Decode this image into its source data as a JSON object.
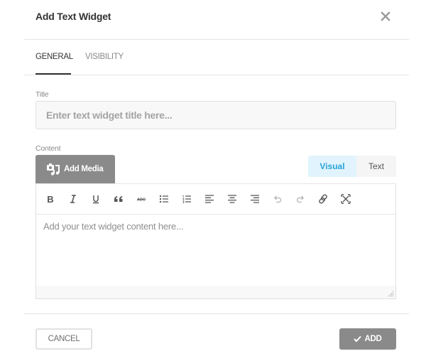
{
  "dialog": {
    "title": "Add Text Widget",
    "close_icon": "close-icon"
  },
  "tabs": [
    {
      "label": "GENERAL",
      "active": true
    },
    {
      "label": "VISIBILITY",
      "active": false
    }
  ],
  "form": {
    "title_label": "Title",
    "title_value": "",
    "title_placeholder": "Enter text widget title here...",
    "content_label": "Content",
    "add_media_label": "Add Media",
    "add_media_icon": "add-media-icon",
    "editor_modes": [
      {
        "label": "Visual",
        "active": true
      },
      {
        "label": "Text",
        "active": false
      }
    ],
    "toolbar": [
      {
        "name": "bold",
        "icon": "bold-icon"
      },
      {
        "name": "italic",
        "icon": "italic-icon"
      },
      {
        "name": "underline",
        "icon": "underline-icon"
      },
      {
        "name": "blockquote",
        "icon": "quote-icon"
      },
      {
        "name": "strikethrough",
        "icon": "strikethrough-icon"
      },
      {
        "name": "bulleted-list",
        "icon": "bullet-list-icon"
      },
      {
        "name": "numbered-list",
        "icon": "numbered-list-icon"
      },
      {
        "name": "align-left",
        "icon": "align-left-icon"
      },
      {
        "name": "align-center",
        "icon": "align-center-icon"
      },
      {
        "name": "align-right",
        "icon": "align-right-icon"
      },
      {
        "name": "undo",
        "icon": "undo-icon"
      },
      {
        "name": "redo",
        "icon": "redo-icon"
      },
      {
        "name": "link",
        "icon": "link-icon"
      },
      {
        "name": "fullscreen",
        "icon": "fullscreen-icon"
      }
    ],
    "toolbar_text": {
      "bold": "B",
      "italic": "I",
      "underline": "U",
      "strike": "ABC"
    },
    "content_value": "",
    "content_placeholder": "Add your text widget content here..."
  },
  "footer": {
    "cancel_label": "CANCEL",
    "add_label": "ADD",
    "add_icon": "check-icon"
  },
  "colors": {
    "accent": "#2aa3d8",
    "accent_bg": "#e1f4fd",
    "button_gray": "#8a8a8a"
  }
}
